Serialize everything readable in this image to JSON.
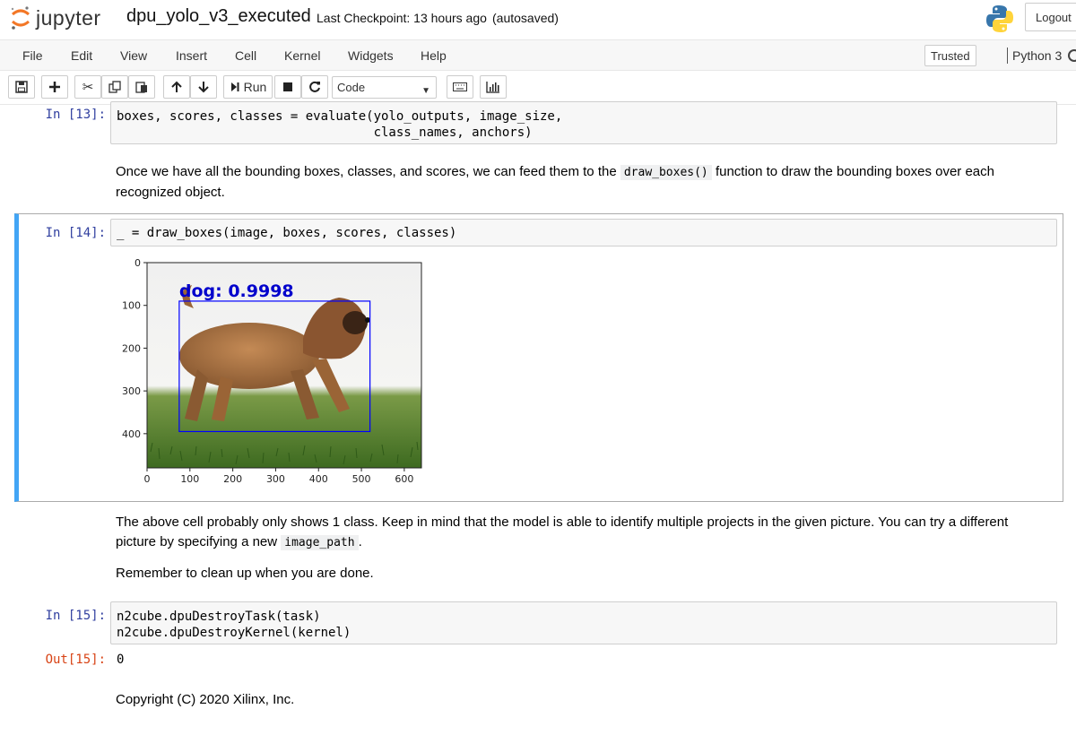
{
  "header": {
    "logo_text": "jupyter",
    "notebook_name": "dpu_yolo_v3_executed",
    "checkpoint": "Last Checkpoint: 13 hours ago",
    "autosave": "(autosaved)",
    "logout": "Logout",
    "logo_icon": "jupyter-logo-icon",
    "python_icon": "python-logo-icon"
  },
  "menubar": {
    "items": [
      "File",
      "Edit",
      "View",
      "Insert",
      "Cell",
      "Kernel",
      "Widgets",
      "Help"
    ],
    "trusted": "Trusted",
    "kernel": "Python 3"
  },
  "toolbar": {
    "run_label": "Run",
    "cell_type": "Code",
    "icons": [
      "save-icon",
      "plus-icon",
      "cut-icon",
      "copy-icon",
      "paste-icon",
      "arrow-up-icon",
      "arrow-down-icon",
      "run-icon",
      "stop-icon",
      "restart-icon",
      "keyboard-icon",
      "chart-icon"
    ]
  },
  "cells": {
    "c13": {
      "prompt": "In [13]:",
      "code": "boxes, scores, classes = evaluate(yolo_outputs, image_size,\n                                  class_names, anchors)"
    },
    "md1": {
      "text_before": "Once we have all the bounding boxes, classes, and scores, we can feed them to the",
      "code": "draw_boxes()",
      "text_after": "function to draw the bounding boxes over each recognized object."
    },
    "c14": {
      "prompt": "In [14]:",
      "code": "_ = draw_boxes(image, boxes, scores, classes)",
      "detection_label": "dog: 0.9998"
    },
    "md2": {
      "p1_before": "The above cell probably only shows 1 class. Keep in mind that the model is able to identify multiple projects in the given picture. You can try a different picture by specifying a new",
      "p1_code": "image_path",
      "p1_after": ".",
      "p2": "Remember to clean up when you are done."
    },
    "c15": {
      "prompt": "In [15]:",
      "code": "n2cube.dpuDestroyTask(task)\nn2cube.dpuDestroyKernel(kernel)",
      "out_prompt": "Out[15]:",
      "out_value": "0"
    },
    "md3": {
      "text": "Copyright (C) 2020 Xilinx, Inc."
    }
  },
  "chart_data": {
    "type": "image",
    "x_ticks": [
      "0",
      "100",
      "200",
      "300",
      "400",
      "500",
      "600"
    ],
    "y_ticks": [
      "0",
      "100",
      "200",
      "300",
      "400"
    ],
    "xlim": [
      0,
      640
    ],
    "ylim": [
      480,
      0
    ],
    "box": {
      "label": "dog: 0.9998",
      "x0": 75,
      "y0": 90,
      "x1": 520,
      "y1": 395,
      "color": "#0000ff"
    }
  }
}
